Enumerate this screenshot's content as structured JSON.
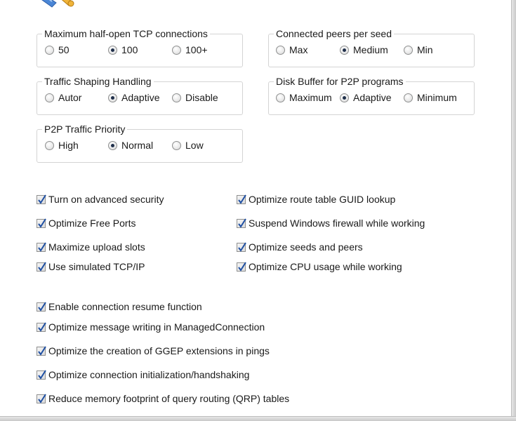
{
  "groups": {
    "tcp": {
      "title": "Maximum half-open TCP connections",
      "options": [
        "50",
        "100",
        "100+"
      ],
      "selected": 1
    },
    "peers": {
      "title": "Connected peers per seed",
      "options": [
        "Max",
        "Medium",
        "Min"
      ],
      "selected": 1
    },
    "shaping": {
      "title": "Traffic Shaping Handling",
      "options": [
        "Autor",
        "Adaptive",
        "Disable"
      ],
      "selected": 1
    },
    "buffer": {
      "title": "Disk Buffer for P2P programs",
      "options": [
        "Maximum",
        "Adaptive",
        "Minimum"
      ],
      "selected": 1
    },
    "priority": {
      "title": "P2P Traffic Priority",
      "options": [
        "High",
        "Normal",
        "Low"
      ],
      "selected": 1
    }
  },
  "checks_left": [
    {
      "label": "Turn on advanced security",
      "checked": true
    },
    {
      "label": "Optimize Free Ports",
      "checked": true
    },
    {
      "label": "Maximize upload slots",
      "checked": true
    },
    {
      "label": "Use simulated TCP/IP",
      "checked": true
    }
  ],
  "checks_right": [
    {
      "label": "Optimize route table GUID lookup",
      "checked": true
    },
    {
      "label": "Suspend Windows firewall while working",
      "checked": true
    },
    {
      "label": "Optimize seeds and peers",
      "checked": true
    },
    {
      "label": "Optimize CPU usage while working",
      "checked": true
    }
  ],
  "checks_bottom": [
    {
      "label": "Enable connection resume function",
      "checked": true
    },
    {
      "label": "Optimize message writing in ManagedConnection",
      "checked": true
    },
    {
      "label": "Optimize the creation of GGEP extensions in pings",
      "checked": true
    },
    {
      "label": "Optimize connection initialization/handshaking",
      "checked": true
    },
    {
      "label": "Reduce memory footprint of query routing (QRP) tables",
      "checked": true
    }
  ],
  "icons": {
    "app": "tools-icon"
  }
}
